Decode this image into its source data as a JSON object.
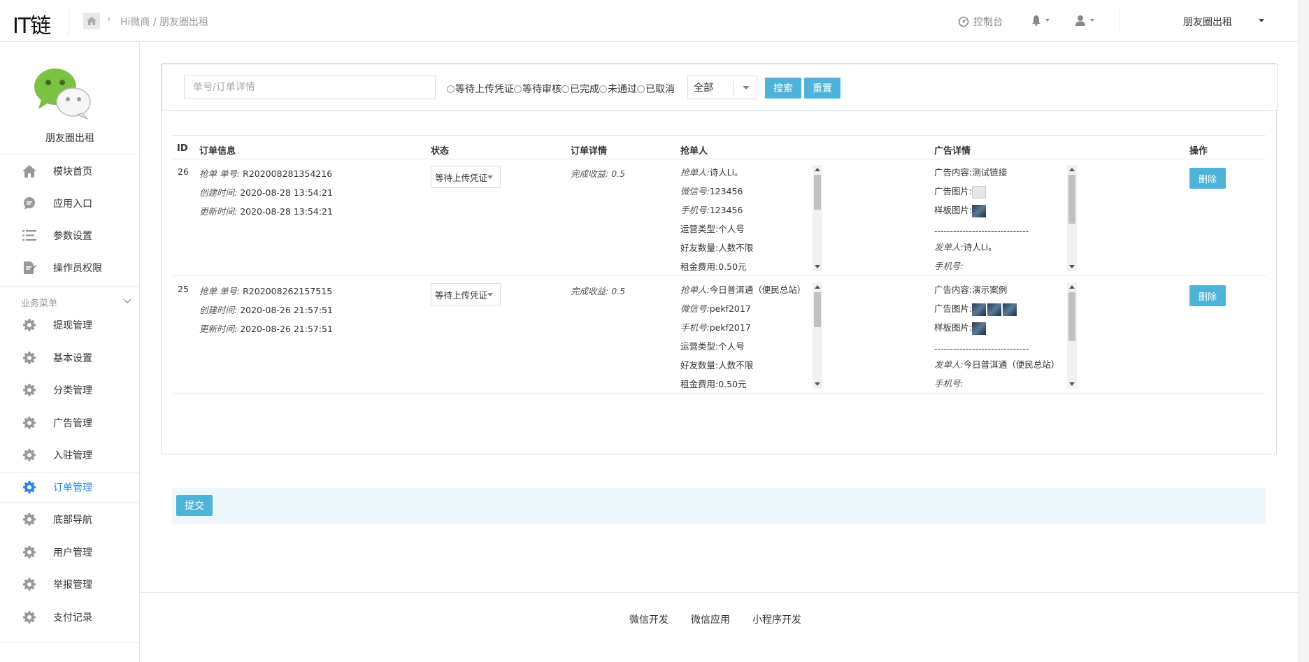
{
  "header": {
    "logo": "IT链",
    "breadcrumb": "Hi微商 / 朋友圈出租",
    "console_label": "控制台",
    "account_label": "朋友圈出租"
  },
  "sidebar": {
    "app_name": "朋友圈出租",
    "top_items": [
      {
        "label": "模块首页",
        "icon": "home-icon"
      },
      {
        "label": "应用入口",
        "icon": "chat-bubble-icon"
      },
      {
        "label": "参数设置",
        "icon": "list-icon"
      },
      {
        "label": "操作员权限",
        "icon": "edit-document-icon"
      }
    ],
    "section_label": "业务菜单",
    "menu_items": [
      {
        "label": "提现管理",
        "icon": "gear-icon",
        "active": false
      },
      {
        "label": "基本设置",
        "icon": "gear-icon",
        "active": false
      },
      {
        "label": "分类管理",
        "icon": "gear-icon",
        "active": false
      },
      {
        "label": "广告管理",
        "icon": "gear-icon",
        "active": false
      },
      {
        "label": "入驻管理",
        "icon": "gear-icon",
        "active": false
      },
      {
        "label": "订单管理",
        "icon": "gear-icon",
        "active": true
      },
      {
        "label": "底部导航",
        "icon": "gear-icon",
        "active": false
      },
      {
        "label": "用户管理",
        "icon": "gear-icon",
        "active": false
      },
      {
        "label": "举报管理",
        "icon": "gear-icon",
        "active": false
      },
      {
        "label": "支付记录",
        "icon": "gear-icon",
        "active": false
      }
    ]
  },
  "filter": {
    "search_placeholder": "单号/订单详情",
    "radios": [
      "等待上传凭证",
      "等待审核",
      "已完成",
      "未通过",
      "已取消"
    ],
    "select_value": "全部",
    "search_label": "搜索",
    "reset_label": "重置"
  },
  "table": {
    "headers": [
      "ID",
      "订单信息",
      "状态",
      "订单详情",
      "抢单人",
      "广告详情",
      "操作"
    ],
    "rows": [
      {
        "id": "26",
        "order_no_label": "抢单 单号:",
        "order_no": "R202008281354216",
        "created_label": "创建时间:",
        "created": "2020-08-28 13:54:21",
        "updated_label": "更新时间:",
        "updated": "2020-08-28 13:54:21",
        "status": "等待上传凭证",
        "detail_label": "完成收益:",
        "detail_value": "0.5",
        "grabber_name_label": "抢单人:",
        "grabber_name": "诗人Li。",
        "wechat_label": "微信号:",
        "wechat": "123456",
        "phone_label": "手机号:",
        "phone": "123456",
        "op_type_label": "运营类型:",
        "op_type": "个人号",
        "friends_label": "好友数量:",
        "friends": "人数不限",
        "rent_label": "租金费用:",
        "rent": "0.50元",
        "ad_content_label": "广告内容:",
        "ad_content": "测试链接",
        "ad_images_label": "广告图片:",
        "sample_label": "样板图片:",
        "ad_sep": "------------------------------",
        "publisher_label": "发单人:",
        "publisher": "诗人Li。",
        "pub_phone_label": "手机号:",
        "delete_label": "删除"
      },
      {
        "id": "25",
        "order_no_label": "抢单 单号:",
        "order_no": "R202008262157515",
        "created_label": "创建时间:",
        "created": "2020-08-26 21:57:51",
        "updated_label": "更新时间:",
        "updated": "2020-08-26 21:57:51",
        "status": "等待上传凭证",
        "detail_label": "完成收益:",
        "detail_value": "0.5",
        "grabber_name_label": "抢单人:",
        "grabber_name": "今日普洱通（便民总站）",
        "wechat_label": "微信号:",
        "wechat": "pekf2017",
        "phone_label": "手机号:",
        "phone": "pekf2017",
        "op_type_label": "运营类型:",
        "op_type": "个人号",
        "friends_label": "好友数量:",
        "friends": "人数不限",
        "rent_label": "租金费用:",
        "rent": "0.50元",
        "ad_content_label": "广告内容:",
        "ad_content": "演示案例",
        "ad_images_label": "广告图片:",
        "sample_label": "样板图片:",
        "ad_sep": "------------------------------",
        "publisher_label": "发单人:",
        "publisher": "今日普洱通（便民总站）",
        "pub_phone_label": "手机号:",
        "delete_label": "删除"
      }
    ],
    "submit_label": "提交"
  },
  "footer": {
    "links": [
      "微信开发",
      "微信应用",
      "小程序开发"
    ]
  }
}
